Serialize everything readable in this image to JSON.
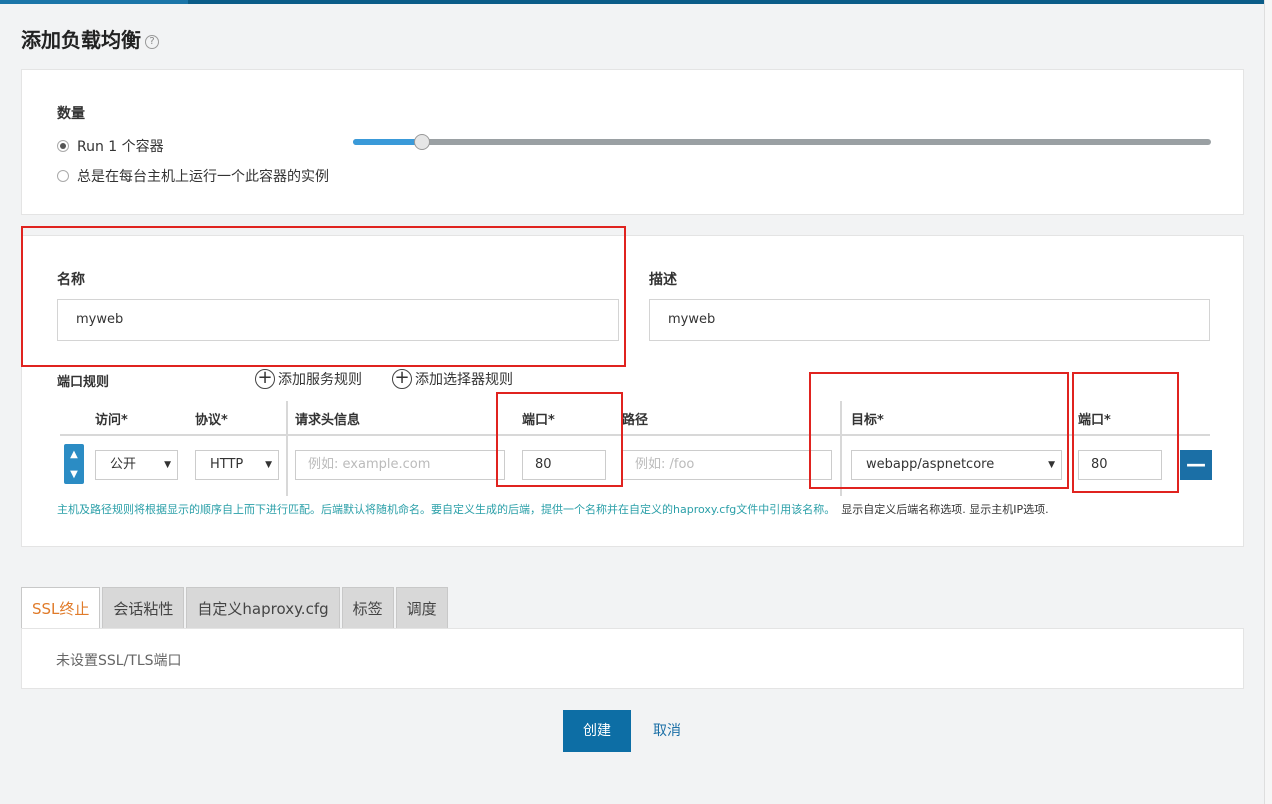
{
  "page": {
    "title": "添加负载均衡",
    "help_icon": "?"
  },
  "scale": {
    "label": "数量",
    "options": [
      {
        "label": "Run 1 个容器",
        "selected": true
      },
      {
        "label": "总是在每台主机上运行一个此容器的实例",
        "selected": false
      }
    ],
    "slider_fraction": 0.08
  },
  "name": {
    "label": "名称",
    "value": "myweb"
  },
  "description": {
    "label": "描述",
    "value": "myweb"
  },
  "port_rules": {
    "label": "端口规则",
    "add_service_rule": "添加服务规则",
    "add_selector_rule": "添加选择器规则",
    "headers": {
      "access": "访问*",
      "protocol": "协议*",
      "request_host": "请求头信息",
      "port": "端口*",
      "path": "路径",
      "target": "目标*",
      "target_port": "端口*"
    },
    "row": {
      "access": "公开",
      "protocol": "HTTP",
      "host_placeholder": "例如: example.com",
      "port": "80",
      "path_placeholder": "例如: /foo",
      "target": "webapp/aspnetcore",
      "target_port": "80"
    },
    "hint": "主机及路径规则将根据显示的顺序自上而下进行匹配。后端默认将随机命名。要自定义生成的后端，提供一个名称并在自定义的haproxy.cfg文件中引用该名称。",
    "hint_links": "显示自定义后端名称选项. 显示主机IP选项."
  },
  "tabs": [
    {
      "label": "SSL终止",
      "active": true
    },
    {
      "label": "会话粘性",
      "active": false
    },
    {
      "label": "自定义haproxy.cfg",
      "active": false
    },
    {
      "label": "标签",
      "active": false
    },
    {
      "label": "调度",
      "active": false
    }
  ],
  "tab_content": "未设置SSL/TLS端口",
  "actions": {
    "create": "创建",
    "cancel": "取消"
  },
  "colors": {
    "primary": "#0d6ea5",
    "annotation": "#e0231f",
    "active_tab": "#e07b2a",
    "hint": "#2a9fa8"
  }
}
